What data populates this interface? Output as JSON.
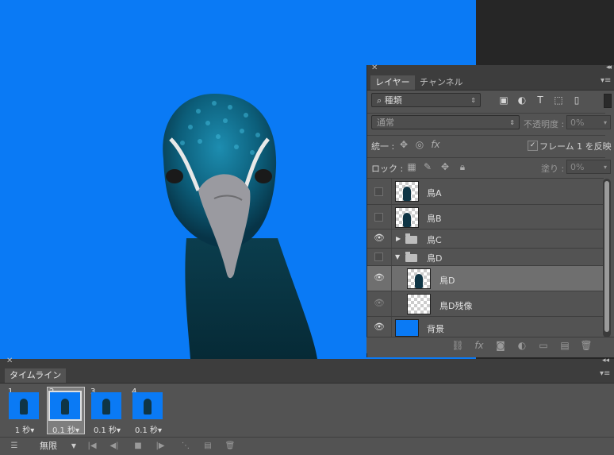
{
  "canvas": {
    "background": "#0a7af5"
  },
  "layers_panel": {
    "tabs": [
      {
        "label": "レイヤー",
        "active": true
      },
      {
        "label": "チャンネル",
        "active": false
      }
    ],
    "filter": {
      "label": "種類",
      "icon": "search-icon"
    },
    "blend_mode": "通常",
    "opacity": {
      "label": "不透明度 :",
      "value": "0%"
    },
    "unify": {
      "label": "統一 :",
      "propagate_label": "フレーム 1 を反映",
      "propagate_checked": true
    },
    "lock": {
      "label": "ロック :"
    },
    "fill": {
      "label": "塗り :",
      "value": "0%"
    },
    "layers": [
      {
        "name": "鳥A",
        "visible": false,
        "type": "layer"
      },
      {
        "name": "鳥B",
        "visible": false,
        "type": "layer"
      },
      {
        "name": "鳥C",
        "visible": true,
        "type": "group",
        "expanded": false
      },
      {
        "name": "鳥D",
        "visible": false,
        "type": "group",
        "expanded": true
      },
      {
        "name": "鳥D",
        "visible": true,
        "type": "layer",
        "selected": true,
        "indent": true
      },
      {
        "name": "鳥D残像",
        "visible": true,
        "type": "layer",
        "indent": true
      },
      {
        "name": "背景",
        "visible": true,
        "type": "background",
        "color": "#0a7af5"
      }
    ]
  },
  "timeline": {
    "tab_label": "タイムライン",
    "frames": [
      {
        "number": "1",
        "delay": "1 秒▾",
        "selected": false
      },
      {
        "number": "2",
        "delay": "0.1 秒▾",
        "selected": true
      },
      {
        "number": "3",
        "delay": "0.1 秒▾",
        "selected": false
      },
      {
        "number": "4",
        "delay": "0.1 秒▾",
        "selected": false
      }
    ],
    "loop": "無限"
  }
}
